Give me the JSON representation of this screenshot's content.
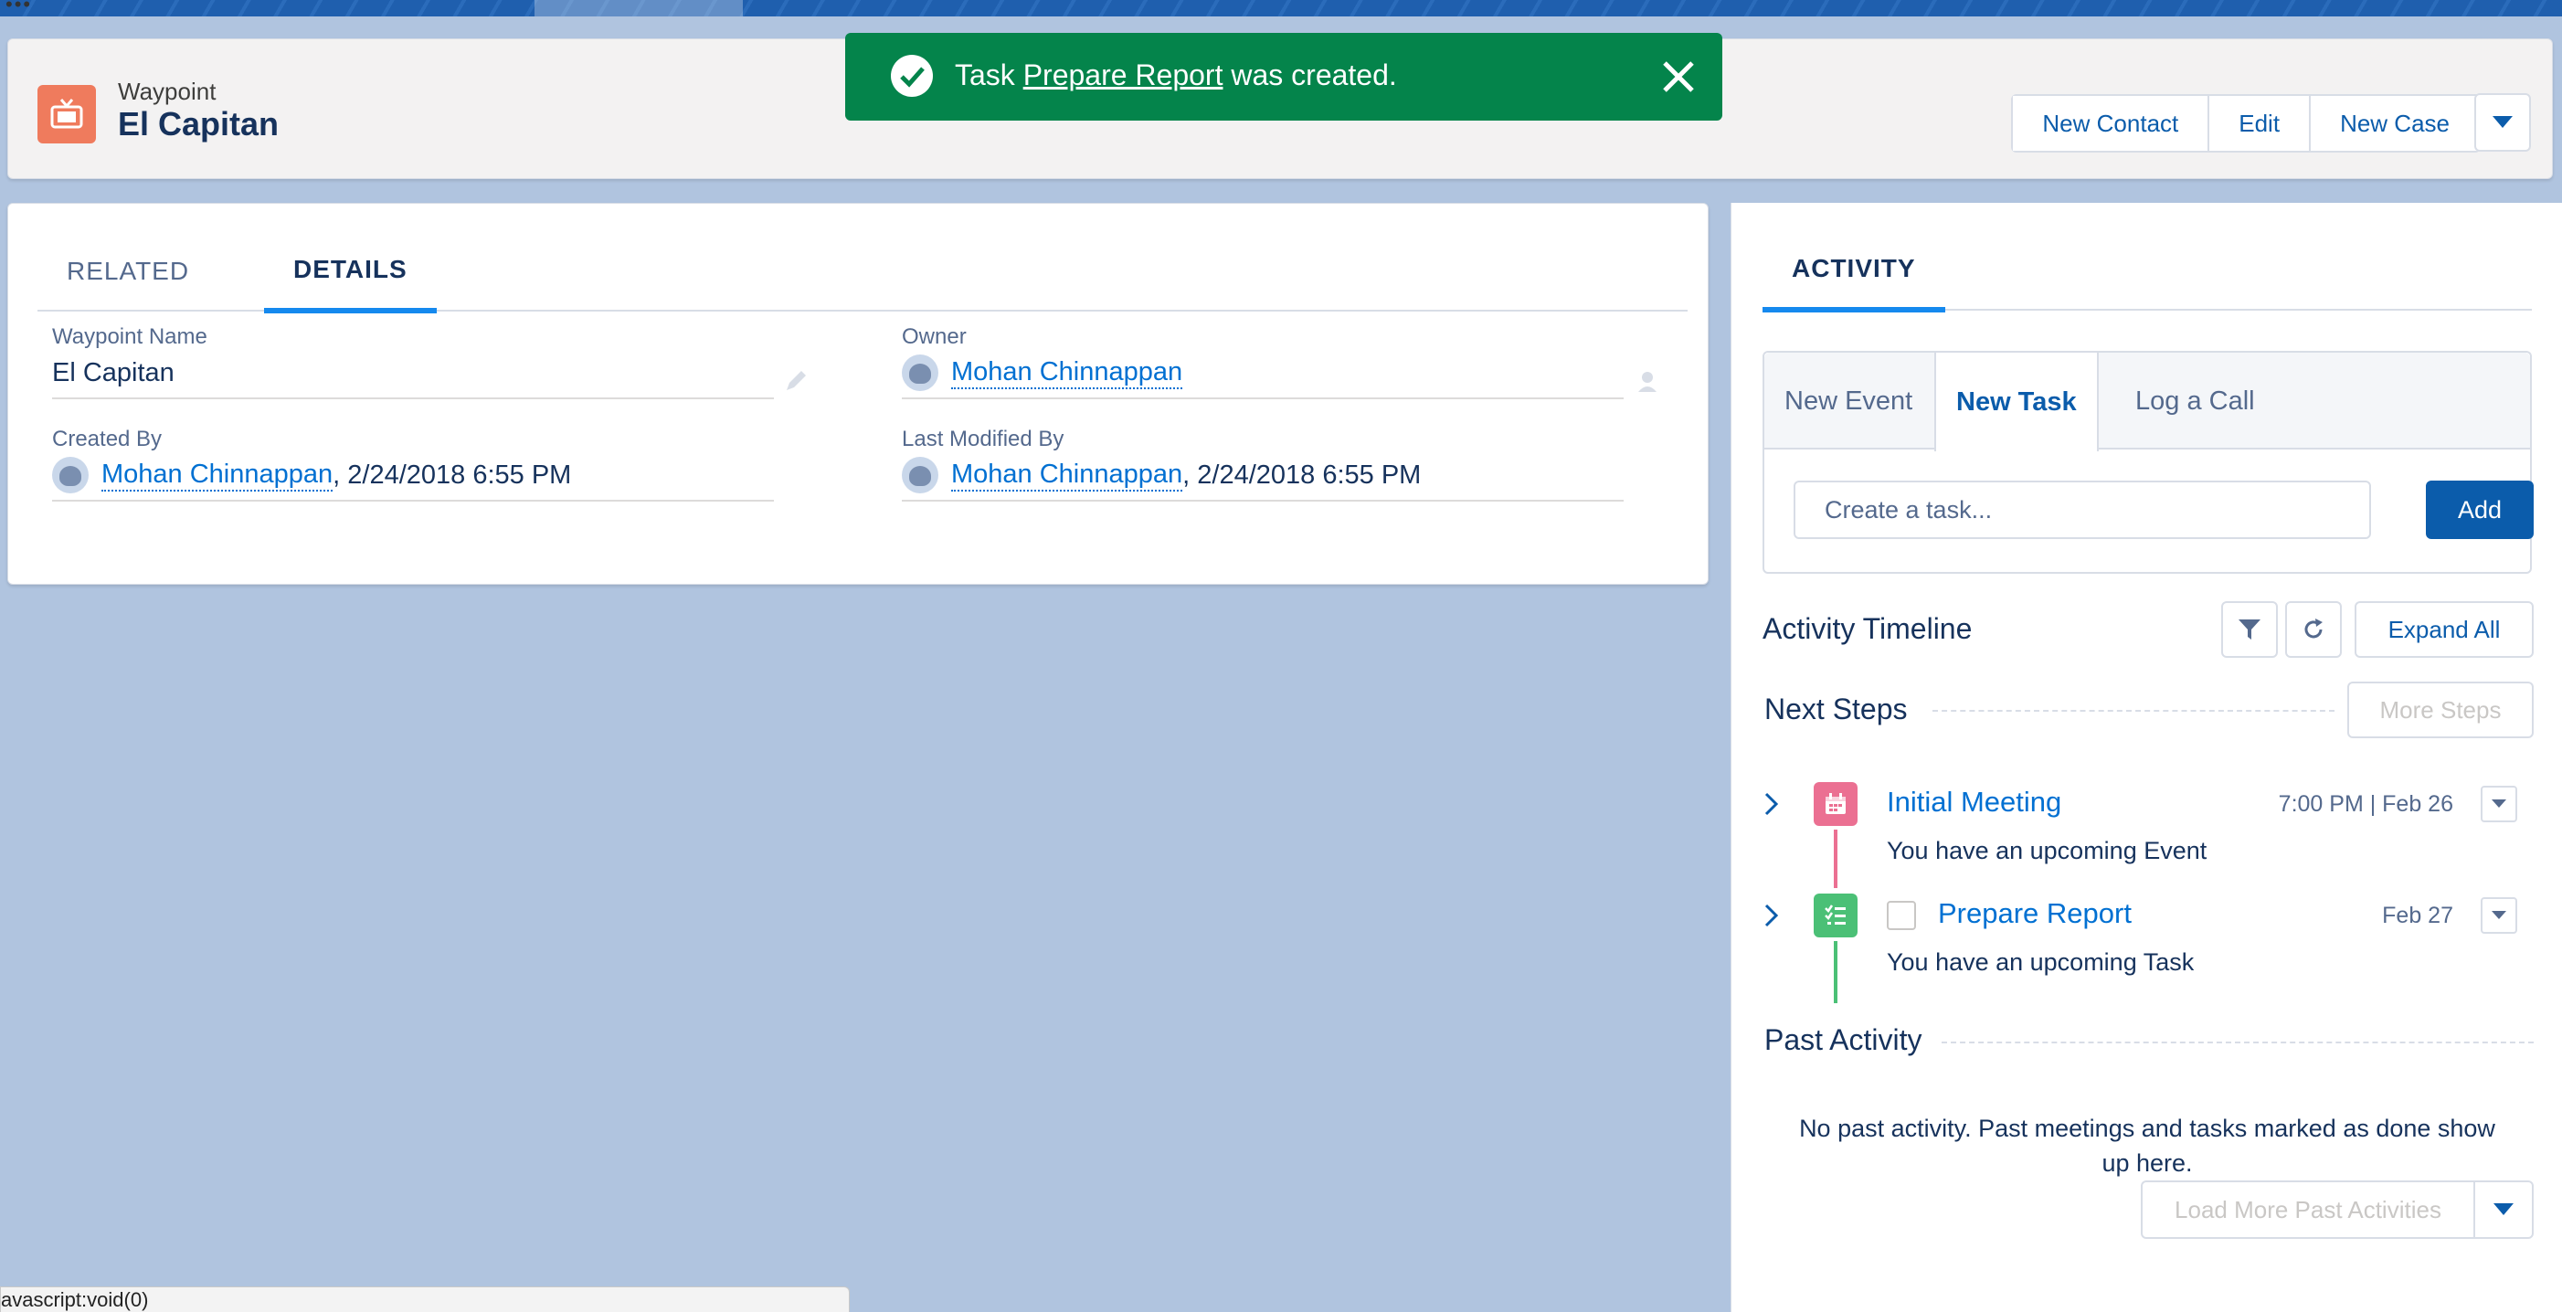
{
  "status_bar": {
    "url": "avascript:void(0)"
  },
  "header": {
    "object_type": "Waypoint",
    "record_name": "El Capitan",
    "icon": "tv-icon",
    "actions": [
      "New Contact",
      "Edit",
      "New Case"
    ],
    "colors": {
      "icon_bg": "#ef7b5d"
    }
  },
  "toast": {
    "prefix": "Task ",
    "link": "Prepare Report",
    "suffix": " was created.",
    "color": "#04844b"
  },
  "details": {
    "tabs": [
      "RELATED",
      "DETAILS"
    ],
    "active_tab": "DETAILS",
    "fields": {
      "waypoint_name": {
        "label": "Waypoint Name",
        "value": "El Capitan"
      },
      "owner": {
        "label": "Owner",
        "value": "Mohan Chinnappan"
      },
      "created_by": {
        "label": "Created By",
        "user": "Mohan Chinnappan",
        "date": ", 2/24/2018 6:55 PM"
      },
      "last_modified_by": {
        "label": "Last Modified By",
        "user": "Mohan Chinnappan",
        "date": ", 2/24/2018 6:55 PM"
      }
    }
  },
  "activity": {
    "tab": "ACTIVITY",
    "composer": {
      "tabs": [
        "New Event",
        "New Task",
        "Log a Call"
      ],
      "active_tab": "New Task",
      "placeholder": "Create a task...",
      "add_label": "Add"
    },
    "timeline_title": "Activity Timeline",
    "expand_all": "Expand All",
    "next_steps_title": "Next Steps",
    "more_steps": "More Steps",
    "items": [
      {
        "subject": "Initial Meeting",
        "desc": "You have an upcoming Event",
        "date": "7:00 PM | Feb 26",
        "icon": "calendar-icon",
        "color": "#eb7092"
      },
      {
        "subject": "Prepare Report",
        "desc": "You have an upcoming Task",
        "date": "Feb 27",
        "icon": "task-icon",
        "color": "#4bc076"
      }
    ],
    "past_title": "Past Activity",
    "past_message": "No past activity. Past meetings and tasks marked as done show up here.",
    "load_more": "Load More Past Activities"
  }
}
